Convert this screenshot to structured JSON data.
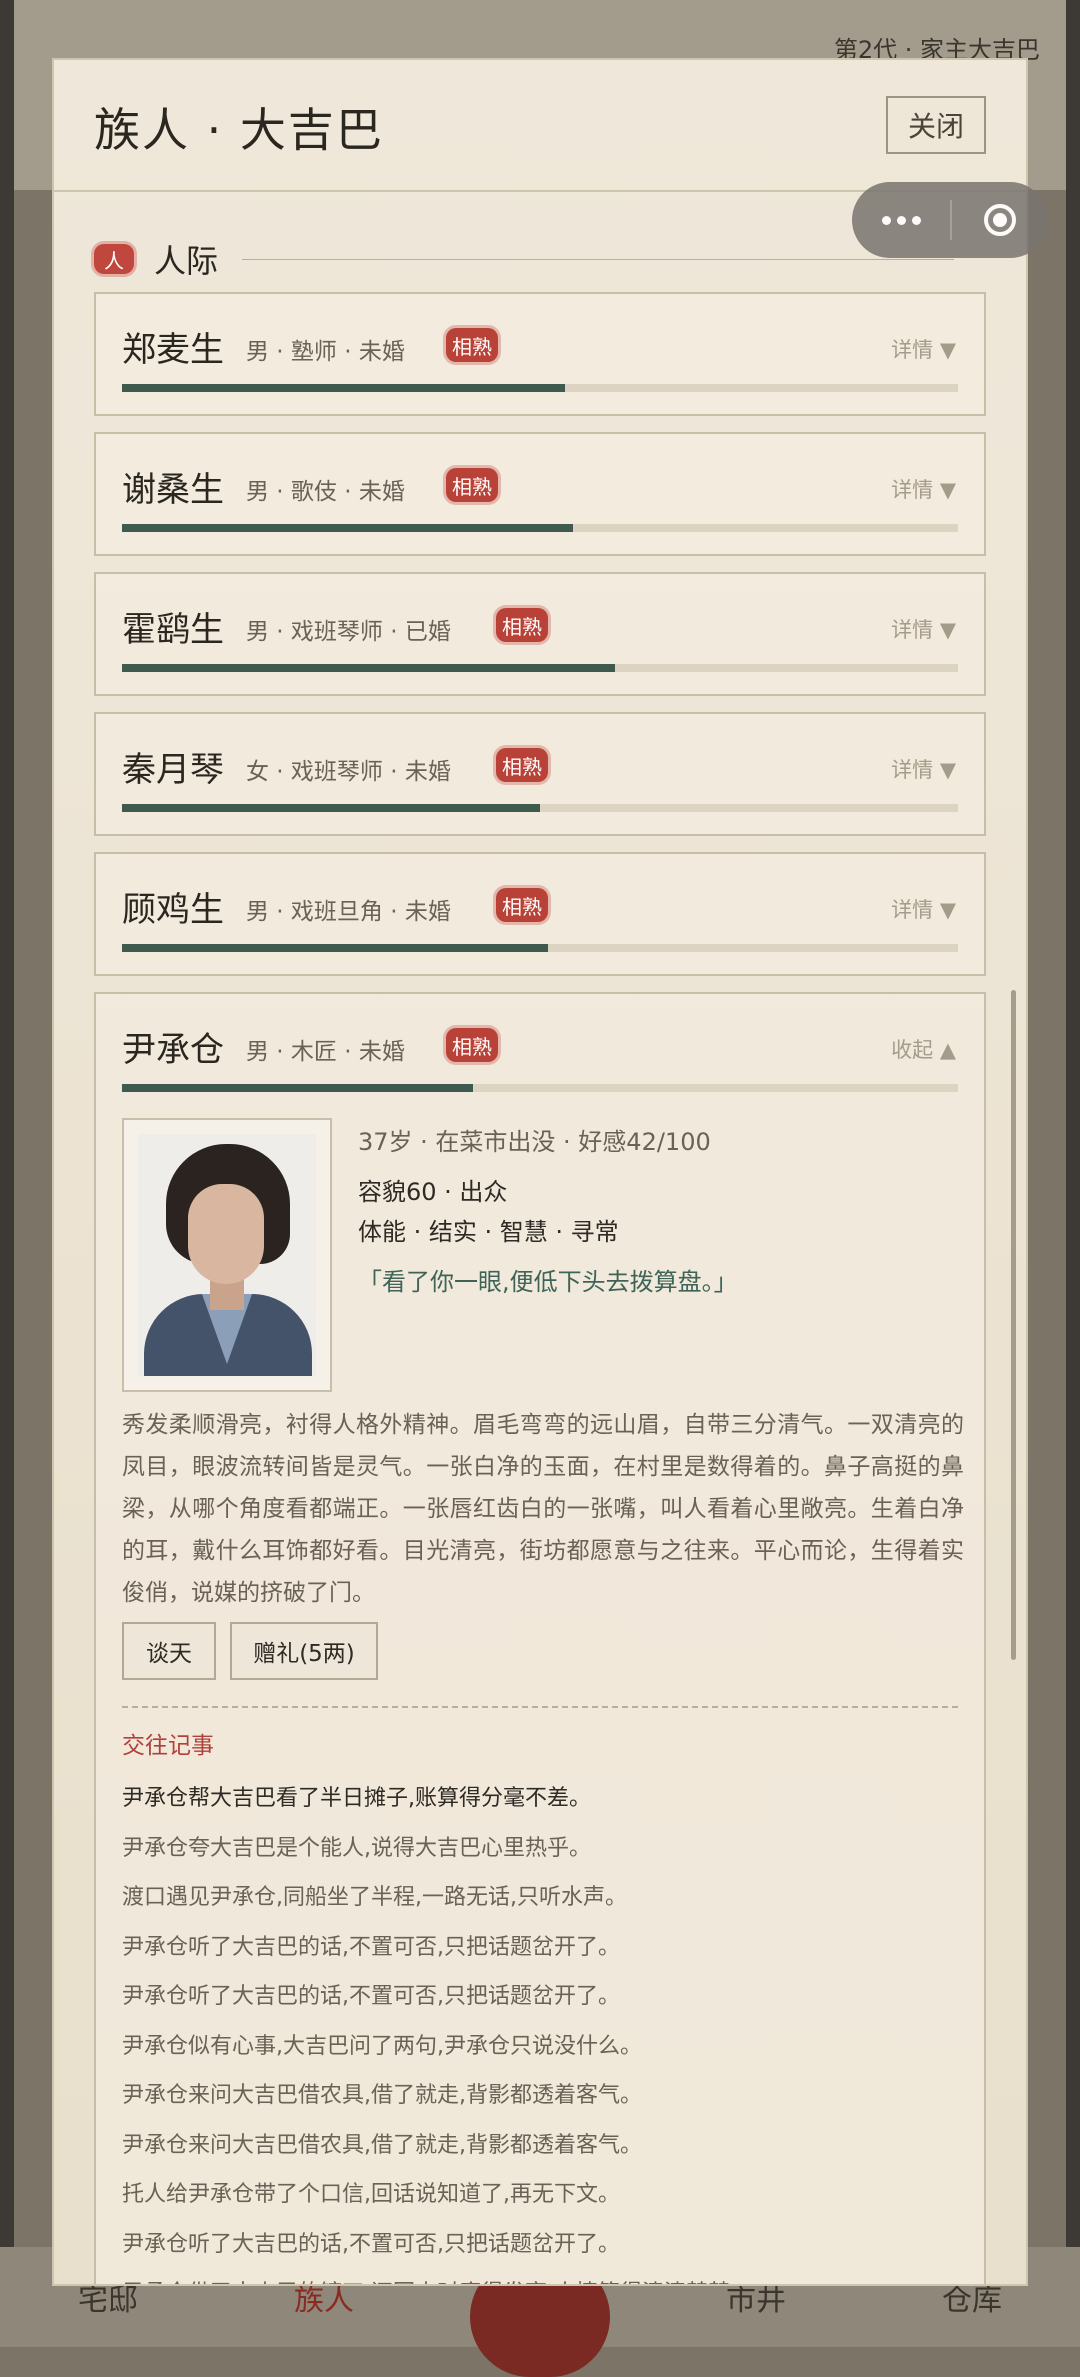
{
  "background": {
    "generation_text": "第2代 · 家主大吉巴",
    "nav": [
      "宅邸",
      "族人",
      "",
      "市井",
      "仓库"
    ]
  },
  "modal": {
    "title": "族人 · 大吉巴",
    "close_label": "关闭",
    "section_icon": "人",
    "section_title": "人际"
  },
  "people": [
    {
      "name": "郑麦生",
      "meta": "男 · 塾师 · 未婚",
      "tag": "相熟",
      "detail": "详情 ▼",
      "affection": 0.53
    },
    {
      "name": "谢桑生",
      "meta": "男 · 歌伎 · 未婚",
      "tag": "相熟",
      "detail": "详情 ▼",
      "affection": 0.54
    },
    {
      "name": "霍鹞生",
      "meta": "男 · 戏班琴师 · 已婚",
      "tag": "相熟",
      "detail": "详情 ▼",
      "affection": 0.59
    },
    {
      "name": "秦月琴",
      "meta": "女 · 戏班琴师 · 未婚",
      "tag": "相熟",
      "detail": "详情 ▼",
      "affection": 0.5
    },
    {
      "name": "顾鸡生",
      "meta": "男 · 戏班旦角 · 未婚",
      "tag": "相熟",
      "detail": "详情 ▼",
      "affection": 0.51
    }
  ],
  "expanded": {
    "name": "尹承仓",
    "meta": "男 · 木匠 · 未婚",
    "tag": "相熟",
    "collapse": "收起 ▲",
    "affection": 0.42,
    "info_line1": "37岁 · 在菜市出没 · 好感42/100",
    "info_line2": "容貌60 · 出众",
    "info_line3": "体能 · 结实 · 智慧 · 寻常",
    "quote": "「看了你一眼,便低下头去拨算盘。」",
    "description": "秀发柔顺滑亮，衬得人格外精神。眉毛弯弯的远山眉，自带三分清气。一双清亮的凤目，眼波流转间皆是灵气。一张白净的玉面，在村里是数得着的。鼻子高挺的鼻梁，从哪个角度看都端正。一张唇红齿白的一张嘴，叫人看着心里敞亮。生着白净的耳，戴什么耳饰都好看。目光清亮，街坊都愿意与之往来。平心而论，生得着实俊俏，说媒的挤破了门。",
    "btn_chat": "谈天",
    "btn_gift": "赠礼(5两)",
    "log_title": "交往记事",
    "logs": [
      "尹承仓帮大吉巴看了半日摊子,账算得分毫不差。",
      "尹承仓夸大吉巴是个能人,说得大吉巴心里热乎。",
      "渡口遇见尹承仓,同船坐了半程,一路无话,只听水声。",
      "尹承仓听了大吉巴的话,不置可否,只把话题岔开了。",
      "尹承仓听了大吉巴的话,不置可否,只把话题岔开了。",
      "尹承仓似有心事,大吉巴问了两句,尹承仓只说没什么。",
      "尹承仓来问大吉巴借农具,借了就走,背影都透着客气。",
      "尹承仓来问大吉巴借农具,借了就走,背影都透着客气。",
      "托人给尹承仓带了个口信,回话说知道了,再无下文。",
      "尹承仓听了大吉巴的话,不置可否,只把话题岔开了。",
      "尹承仓借了大吉巴的镰刀,还回来时磨得发亮,人情算得清清楚楚。"
    ]
  }
}
